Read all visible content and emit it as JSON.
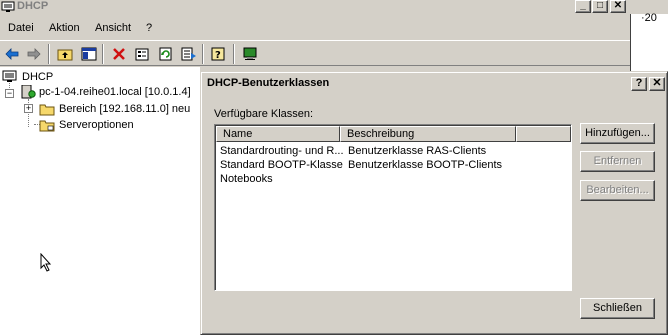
{
  "app": {
    "title": "DHCP"
  },
  "clock_partial": "·20",
  "menu": [
    {
      "label": "Datei"
    },
    {
      "label": "Aktion"
    },
    {
      "label": "Ansicht"
    },
    {
      "label": "?"
    }
  ],
  "toolbar": {
    "icons": [
      "back-arrow-icon",
      "forward-arrow-icon",
      "up-folder-icon",
      "show-hide-tree-icon",
      "delete-icon",
      "properties-icon",
      "refresh-icon",
      "export-list-icon",
      "help-icon",
      "console-icon"
    ]
  },
  "tree": {
    "root": "DHCP",
    "server": "pc-1-04.reihe01.local [10.0.1.4]",
    "scope": "Bereich [192.168.11.0] neu",
    "server_options": "Serveroptionen"
  },
  "dialog": {
    "title": "DHCP-Benutzerklassen",
    "help_button": "?",
    "close_x": "✕",
    "available_label": "Verfügbare Klassen:",
    "columns": {
      "name": "Name",
      "description": "Beschreibung"
    },
    "rows": [
      {
        "name": "Standardrouting- und R...",
        "description": "Benutzerklasse RAS-Clients"
      },
      {
        "name": "Standard BOOTP-Klasse",
        "description": "Benutzerklasse BOOTP-Clients"
      },
      {
        "name": "Notebooks",
        "description": ""
      }
    ],
    "buttons": {
      "add": "Hinzufügen...",
      "remove": "Entfernen",
      "edit": "Bearbeiten...",
      "close": "Schließen"
    }
  }
}
